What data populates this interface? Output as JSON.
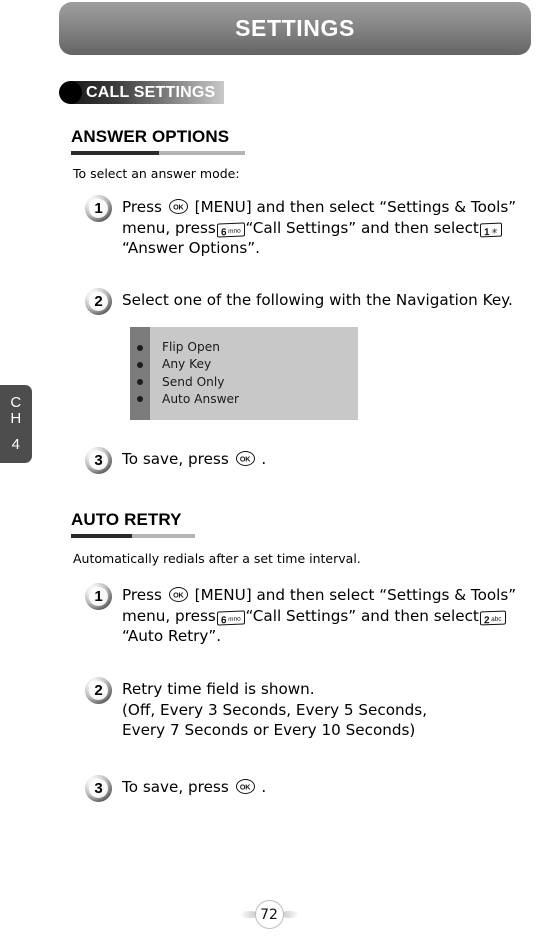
{
  "header": {
    "title": "SETTINGS"
  },
  "chapter_tab": {
    "c": "C",
    "h": "H",
    "number": "4"
  },
  "section_badge": {
    "label": "CALL SETTINGS"
  },
  "sections": [
    {
      "heading": "ANSWER OPTIONS",
      "lead": "To select an answer mode:",
      "steps": [
        {
          "number": "1",
          "line1_a": "Press",
          "line1_b": "[MENU] and then select “Settings &",
          "line2_a": "Tools” menu, press",
          "key_6": {
            "digit": "6",
            "letters": "mno"
          },
          "line2_b": "“Call Settings” and then",
          "line3_a": "select",
          "key_1": {
            "digit": "1",
            "letters": "✳"
          },
          "line3_b": "“Answer Options”."
        },
        {
          "number": "2",
          "text": "Select one of the following with the Navigation Key."
        },
        {
          "number": "3",
          "text_a": "To save, press",
          "text_b": "."
        }
      ],
      "options": [
        "Flip Open",
        "Any Key",
        "Send Only",
        "Auto Answer"
      ]
    },
    {
      "heading": "AUTO RETRY",
      "lead": "Automatically redials after a set time interval.",
      "steps": [
        {
          "number": "1",
          "line1_a": "Press",
          "line1_b": "[MENU] and then select “Settings &",
          "line2_a": "Tools” menu, press",
          "key_6": {
            "digit": "6",
            "letters": "mno"
          },
          "line2_b": "“Call Settings” and then",
          "line3_a": "select",
          "key_2": {
            "digit": "2",
            "letters": "abc"
          },
          "line3_b": "“Auto Retry”."
        },
        {
          "number": "2",
          "line1": "Retry time field is shown.",
          "line2": "(Off, Every 3 Seconds, Every 5 Seconds,",
          "line3": "Every 7 Seconds or Every 10 Seconds)"
        },
        {
          "number": "3",
          "text_a": "To save, press",
          "text_b": "."
        }
      ]
    }
  ],
  "footer": {
    "page_number": "72"
  }
}
